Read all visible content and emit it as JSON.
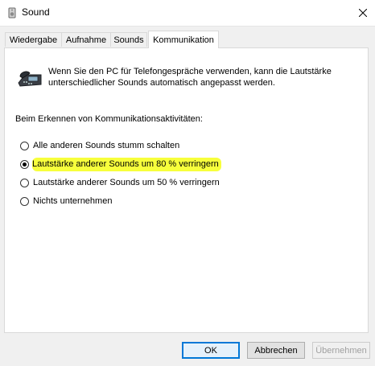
{
  "window": {
    "title": "Sound"
  },
  "tabs": [
    "Wiedergabe",
    "Aufnahme",
    "Sounds",
    "Kommunikation"
  ],
  "active_tab": "Kommunikation",
  "intro_text": "Wenn Sie den PC für Telefongespräche verwenden, kann die Lautstärke unterschiedlicher Sounds automatisch angepasst werden.",
  "section_label": "Beim Erkennen von Kommunikationsaktivitäten:",
  "options": [
    {
      "label": "Alle anderen Sounds stumm schalten",
      "checked": false
    },
    {
      "label": "Lautstärke anderer Sounds um 80 % verringern",
      "checked": true
    },
    {
      "label": "Lautstärke anderer Sounds um 50 % verringern",
      "checked": false
    },
    {
      "label": "Nichts unternehmen",
      "checked": false
    }
  ],
  "buttons": {
    "ok": "OK",
    "cancel": "Abbrechen",
    "apply": "Übernehmen"
  },
  "colors": {
    "highlight": "#f7ff3c",
    "default_button_border": "#0078d7"
  }
}
